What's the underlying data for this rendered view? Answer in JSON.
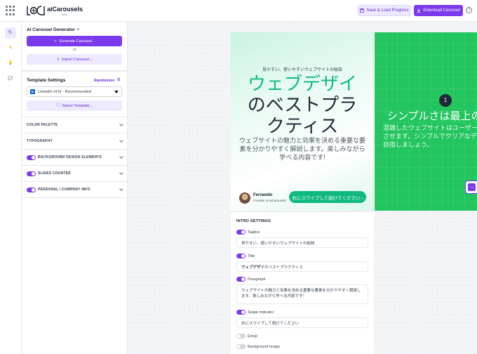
{
  "app": {
    "brand": "aiCarousels",
    "brand_sub": ".com",
    "save_load_label": "Save & Load Progress",
    "download_label": "Download  Carousel",
    "help_glyph": "?"
  },
  "rail": {
    "items": [
      {
        "icon": "text-settings-icon",
        "glyph": "⚙"
      },
      {
        "icon": "palette-icon",
        "glyph": "✎"
      },
      {
        "icon": "lightbulb-icon",
        "glyph": "💡"
      },
      {
        "icon": "chat-icon",
        "glyph": "💬"
      }
    ]
  },
  "panel": {
    "title": "AI Carousel Generator ✧",
    "generate_label": "Generate Carousel...",
    "or_text": "or",
    "import_label": "Import Carousel...",
    "template_settings": "Template Settings",
    "randomize": "Randomize",
    "template_select": "LinkedIn (4:5) - Recommended",
    "select_template_label": "Select Template...",
    "sections": [
      {
        "label": "COLOR PALETTE",
        "toggle": null
      },
      {
        "label": "TYPOGRAPHY",
        "toggle": null
      },
      {
        "label": "BACKGROUND DESIGN ELEMENTS",
        "toggle": true
      },
      {
        "label": "SLIDES COUNTER",
        "toggle": true
      },
      {
        "label": "PERSONAL / COMPANY INFO",
        "toggle": true
      }
    ]
  },
  "slide1": {
    "tagline": "見やすい、使いやすいウェブサイトの秘訣",
    "title_highlight": "ウェブデザイ",
    "title_rest": "のベストプラクティス",
    "paragraph": "ウェブサイトの魅力と効果を決める重要な要素を分かりやすく解説します。楽しみながら学べる内容です!",
    "author_name": "Fernando",
    "author_role": "Founder at aiCarousels",
    "swipe": "右にスワイプして続けてください ›"
  },
  "slide2": {
    "number": "1",
    "title": "シンプルさは最上の",
    "paragraph": "混雑したウェブサイトはユーザーを混乱させます。シンプルでクリアなデザインを目指しましょう。",
    "arrow": "→"
  },
  "intro": {
    "title": "INTRO SETTINGS",
    "fields": [
      {
        "label": "Tagline",
        "enabled": true,
        "value": "見やすい、使いやすいウェブサイトの秘訣"
      },
      {
        "label": "Title",
        "enabled": true,
        "value_bold": "ウェブデザイ",
        "value": "のベストプラクティス"
      },
      {
        "label": "Paragraph",
        "enabled": true,
        "value": "ウェブサイトの魅力と効果を決める重要な要素を分かりやすく解説します。楽しみながら学べる内容です!"
      },
      {
        "label": "Swipe indicator",
        "enabled": true,
        "value": "右にスワイプして続けてください"
      },
      {
        "label": "Emoji",
        "enabled": false
      },
      {
        "label": "Background Image",
        "enabled": false
      }
    ]
  },
  "colors": {
    "accent": "#7c3aed",
    "slide_green": "#22c55e",
    "title_green": "#10b981"
  }
}
